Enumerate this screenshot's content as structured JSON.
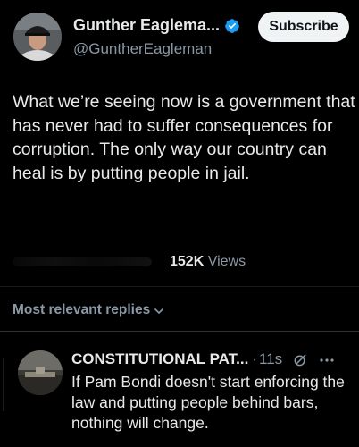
{
  "post": {
    "author_name": "Gunther Eaglema...",
    "author_handle": "@GuntherEagleman",
    "subscribe_label": "Subscribe",
    "text": "What we’re seeing now is a government that has never had to suffer consequences for corruption. The only way our country can heal is by putting people in jail.",
    "views_count": "152K",
    "views_label": "Views"
  },
  "replies_sort": {
    "label": "Most relevant replies"
  },
  "reply": {
    "author_name": "CONSTITUTIONAL PAT...",
    "separator": "·",
    "time": "11s",
    "text": "If Pam Bondi doesn't start enforcing the law and putting people behind bars, nothing will change."
  },
  "colors": {
    "background": "#000000",
    "text_primary": "#e7e9ea",
    "text_secondary": "#8b98a5",
    "verified_blue": "#1d9bf0",
    "button_bg": "#eff3f4"
  },
  "icons": {
    "verified": "verified-badge-icon",
    "chevron": "chevron-down-icon",
    "grok": "grok-icon",
    "more": "more-icon"
  }
}
